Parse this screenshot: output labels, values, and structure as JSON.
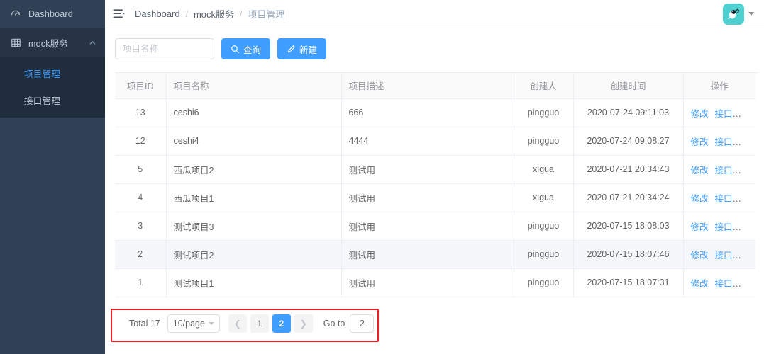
{
  "sidebar": {
    "items": [
      {
        "label": "Dashboard",
        "icon": "dashboard-icon"
      },
      {
        "label": "mock服务",
        "icon": "grid-icon",
        "chevron": "chevron-up-icon"
      }
    ],
    "submenu": [
      {
        "label": "项目管理",
        "active": true
      },
      {
        "label": "接口管理",
        "active": false
      }
    ]
  },
  "navbar": {
    "hamburger_icon": "hamburger-collapse-icon",
    "breadcrumb": [
      "Dashboard",
      "mock服务",
      "项目管理"
    ],
    "separator": "/",
    "avatar_icon": "user-avatar-bird-icon",
    "avatar_color": "#4dd0cf",
    "caret_icon": "caret-down-icon"
  },
  "filter": {
    "search_placeholder": "项目名称",
    "search_value": "",
    "query_button": "查询",
    "query_icon": "search-icon",
    "create_button": "新建",
    "create_icon": "pencil-icon"
  },
  "table": {
    "columns": [
      "项目ID",
      "项目名称",
      "项目描述",
      "创建人",
      "创建时间",
      "操作"
    ],
    "action_labels": [
      "修改",
      "接口mock"
    ],
    "rows": [
      {
        "id": "13",
        "name": "ceshi6",
        "desc": "666",
        "creator": "pingguo",
        "created": "2020-07-24 09:11:03",
        "highlighted": false
      },
      {
        "id": "12",
        "name": "ceshi4",
        "desc": "4444",
        "creator": "pingguo",
        "created": "2020-07-24 09:08:27",
        "highlighted": false
      },
      {
        "id": "5",
        "name": "西瓜项目2",
        "desc": "测试用",
        "creator": "xigua",
        "created": "2020-07-21 20:34:43",
        "highlighted": false
      },
      {
        "id": "4",
        "name": "西瓜项目1",
        "desc": "测试用",
        "creator": "xigua",
        "created": "2020-07-21 20:34:24",
        "highlighted": false
      },
      {
        "id": "3",
        "name": "测试项目3",
        "desc": "测试用",
        "creator": "pingguo",
        "created": "2020-07-15 18:08:03",
        "highlighted": false
      },
      {
        "id": "2",
        "name": "测试项目2",
        "desc": "测试用",
        "creator": "pingguo",
        "created": "2020-07-15 18:07:46",
        "highlighted": true
      },
      {
        "id": "1",
        "name": "测试项目1",
        "desc": "测试用",
        "creator": "pingguo",
        "created": "2020-07-15 18:07:31",
        "highlighted": false
      }
    ]
  },
  "pagination": {
    "total_label": "Total 17",
    "page_size": "10/page",
    "prev_icon": "chevron-left-icon",
    "next_icon": "chevron-right-icon",
    "pages": [
      "1",
      "2"
    ],
    "current_page": "2",
    "goto_label": "Go to",
    "goto_value": "2",
    "annotation_color": "#ed1c24"
  },
  "colors": {
    "sidebar_bg": "#304156",
    "submenu_bg": "#1f2d3d",
    "primary": "#409eff",
    "header_bg": "#fafafa"
  }
}
